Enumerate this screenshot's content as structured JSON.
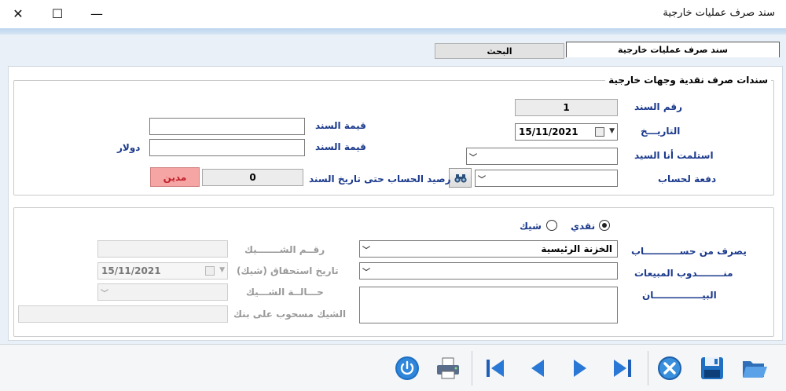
{
  "window": {
    "title": "سند صرف عمليات خارجية",
    "minimize_glyph": "—",
    "maximize_glyph": "☐",
    "close_glyph": "✕"
  },
  "tabs": [
    {
      "label": "سند صرف عمليات خارجية",
      "active": true
    },
    {
      "label": "البحث",
      "active": false
    }
  ],
  "section1": {
    "legend": "سندات صرف نقدية وجهات خارجية",
    "voucher_no_label": "رقم السند",
    "voucher_no_value": "1",
    "date_label": "التاريـــخ",
    "date_value": "15/11/2021",
    "received_by_label": "استلمت أنا السيد",
    "received_by_value": "",
    "pay_to_account_label": "دفعة لحساب",
    "pay_to_account_value": "",
    "voucher_value_label_1": "قيمة السند",
    "voucher_value_1": "",
    "voucher_value_label_2": "قيمة السند",
    "voucher_value_2": "",
    "currency_label": "دولار",
    "balance_label": "رصيد الحساب حتى تاريخ السند",
    "balance_value": "0",
    "balance_status": "مدين"
  },
  "section2": {
    "cash_label": "نقدي",
    "cheque_label": "شيك",
    "selected": "cash",
    "pay_from_account_label": "يصرف من حســـــــــــاب",
    "pay_from_account_value": "الخزنة الرئيسية",
    "sales_rep_label": "منــــــــدوب المبيعات",
    "sales_rep_value": "",
    "statement_label": "البيـــــــــــــــان",
    "statement_value": "",
    "cheque_no_label": "رقــم الشـــــــيك",
    "cheque_no_value": "",
    "due_date_label": "تاريخ استحقاق (شيك)",
    "due_date_value": "15/11/2021",
    "cheque_status_label": "حـــالــة الشـــيك",
    "cheque_status_value": "",
    "drawn_on_bank_label": "الشيك مسحوب على بنك",
    "drawn_on_bank_value": ""
  },
  "colors": {
    "label_blue": "#1b3a8c",
    "debit_bg": "#f6a5a5",
    "debit_text": "#c0202a"
  },
  "toolbar_icons": [
    "power-icon",
    "printer-icon",
    "first-record-icon",
    "previous-record-icon",
    "next-record-icon",
    "last-record-icon",
    "cancel-icon",
    "save-icon",
    "open-folder-icon"
  ]
}
